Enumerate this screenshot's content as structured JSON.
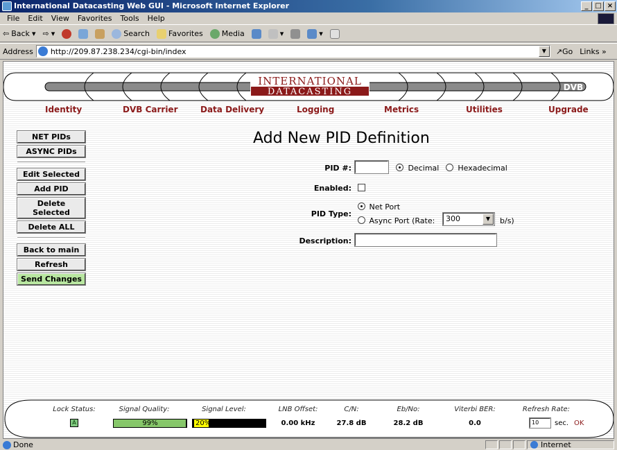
{
  "window": {
    "title": "International Datacasting Web GUI - Microsoft Internet Explorer"
  },
  "menu": [
    "File",
    "Edit",
    "View",
    "Favorites",
    "Tools",
    "Help"
  ],
  "toolbar": {
    "back": "Back",
    "search": "Search",
    "favorites": "Favorites",
    "media": "Media"
  },
  "address": {
    "label": "Address",
    "url": "http://209.87.238.234/cgi-bin/index",
    "go": "Go",
    "links": "Links »"
  },
  "header": {
    "logo_line1": "INTERNATIONAL",
    "logo_line2": "DATACASTING",
    "dvb_logo": "DVB",
    "nav": [
      "Identity",
      "DVB Carrier",
      "Data Delivery",
      "Logging",
      "Metrics",
      "Utilities",
      "Upgrade"
    ]
  },
  "sidebar": {
    "group1": [
      "NET PIDs",
      "ASYNC PIDs"
    ],
    "group2": [
      "Edit Selected",
      "Add PID",
      "Delete Selected",
      "Delete ALL"
    ],
    "group3": [
      "Back to main",
      "Refresh",
      "Send Changes"
    ]
  },
  "form": {
    "title": "Add New PID Definition",
    "pid_label": "PID #:",
    "pid_value": "",
    "radix_decimal": "Decimal",
    "radix_hex": "Hexadecimal",
    "radix_selected": "Decimal",
    "enabled_label": "Enabled:",
    "enabled": false,
    "pid_type_label": "PID Type:",
    "pid_type_net": "Net Port",
    "pid_type_async_prefix": "Async Port (Rate:",
    "pid_type_selected": "Net Port",
    "rate_value": "300",
    "rate_unit": "b/s)",
    "description_label": "Description:",
    "description_value": ""
  },
  "status": {
    "labels": [
      "Lock Status:",
      "Signal Quality:",
      "Signal Level:",
      "LNB Offset:",
      "C/N:",
      "Eb/No:",
      "Viterbi BER:",
      "Refresh Rate:"
    ],
    "lock": "A",
    "signal_quality_text": "99%",
    "signal_quality_fraction": 0.99,
    "signal_level_text": "20%",
    "signal_level_fraction": 0.2,
    "lnb_offset": "0.00 kHz",
    "cn": "27.8 dB",
    "ebno": "28.2 dB",
    "viterbi": "0.0",
    "refresh_value": "10",
    "refresh_unit": "sec.",
    "refresh_ok": "OK",
    "colors": {
      "quality": "#86c76a",
      "level": "#ffff00",
      "nav": "#8b1a1a",
      "ok": "#8b1a1a"
    }
  },
  "ie_status": {
    "left": "Done",
    "zone": "Internet"
  }
}
